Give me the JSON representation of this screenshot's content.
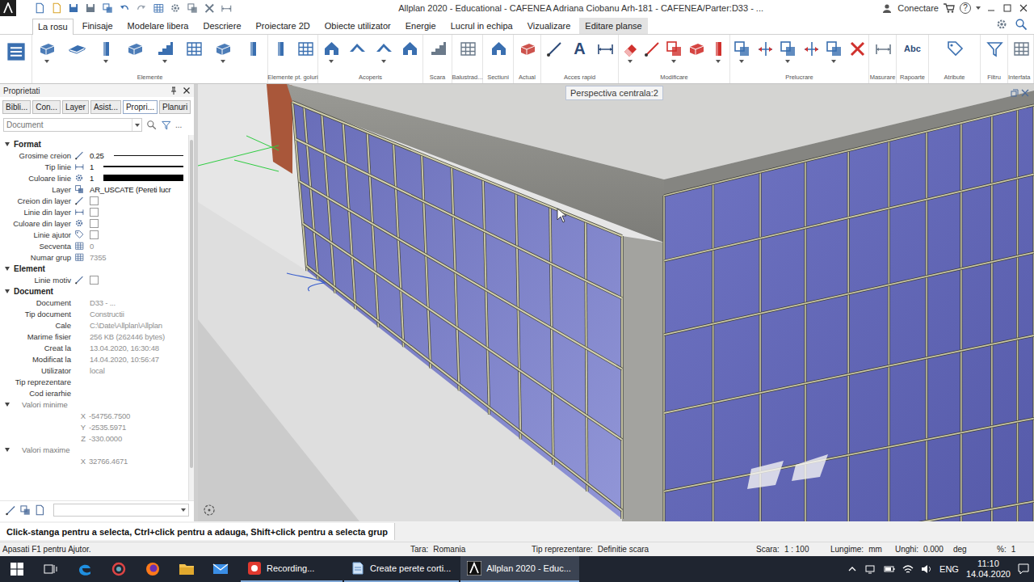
{
  "window": {
    "title": "Allplan 2020 - Educational - CAFENEA Adriana Ciobanu Arh-181 - CAFENEA/Parter:D33 - ...",
    "account": "Conectare",
    "help": "?"
  },
  "ribbon": {
    "tabs": [
      {
        "label": "La rosu",
        "selected": true,
        "highlighted": false
      },
      {
        "label": "Finisaje",
        "selected": false,
        "highlighted": false
      },
      {
        "label": "Modelare libera",
        "selected": false,
        "highlighted": false
      },
      {
        "label": "Descriere",
        "selected": false,
        "highlighted": false
      },
      {
        "label": "Proiectare 2D",
        "selected": false,
        "highlighted": false
      },
      {
        "label": "Obiecte utilizator",
        "selected": false,
        "highlighted": false
      },
      {
        "label": "Energie",
        "selected": false,
        "highlighted": false
      },
      {
        "label": "Lucrul in echipa",
        "selected": false,
        "highlighted": false
      },
      {
        "label": "Vizualizare",
        "selected": false,
        "highlighted": false
      },
      {
        "label": "Editare planse",
        "selected": false,
        "highlighted": true
      }
    ],
    "groups": [
      {
        "label": "Elemente"
      },
      {
        "label": "Elemente pt. goluri"
      },
      {
        "label": "Acoperis"
      },
      {
        "label": "Scara"
      },
      {
        "label": "Balustrad..."
      },
      {
        "label": "Sectiuni"
      },
      {
        "label": "Actual"
      },
      {
        "label": "Acces rapid",
        "glyph": "A"
      },
      {
        "label": "Modificare"
      },
      {
        "label": "Prelucrare"
      },
      {
        "label": "Masurare"
      },
      {
        "label": "Rapoarte",
        "glyph": "Abc"
      },
      {
        "label": "Atribute"
      },
      {
        "label": "Filtru"
      },
      {
        "label": "Interfata"
      }
    ]
  },
  "panel": {
    "title": "Proprietati",
    "tabs": [
      {
        "label": "Bibli...",
        "selected": false
      },
      {
        "label": "Con...",
        "selected": false
      },
      {
        "label": "Layer",
        "selected": false
      },
      {
        "label": "Asist...",
        "selected": false
      },
      {
        "label": "Propri...",
        "selected": true
      },
      {
        "label": "Planuri",
        "selected": false
      }
    ],
    "filter": {
      "placeholder": "Document",
      "more": "..."
    },
    "sections": [
      {
        "label": "Format",
        "expanded": true,
        "rows": [
          {
            "label": "Grosime creion",
            "kind": "pen",
            "value": "0.25",
            "greyed": false
          },
          {
            "label": "Tip linie",
            "kind": "pen",
            "value": "1",
            "greyed": false
          },
          {
            "label": "Culoare linie",
            "kind": "swatch",
            "value": "1",
            "greyed": false
          },
          {
            "label": "Layer",
            "kind": "text",
            "value": "AR_USCATE (Pereti lucr",
            "greyed": false
          },
          {
            "label": "Creion din layer",
            "kind": "checkbox",
            "checked": false,
            "greyed": false
          },
          {
            "label": "Linie din layer",
            "kind": "checkbox",
            "checked": false,
            "greyed": false
          },
          {
            "label": "Culoare din layer",
            "kind": "checkbox",
            "checked": false,
            "greyed": false
          },
          {
            "label": "Linie ajutor",
            "kind": "checkbox",
            "checked": false,
            "greyed": false
          },
          {
            "label": "Secventa",
            "kind": "text",
            "value": "0",
            "greyed": true
          },
          {
            "label": "Numar grup",
            "kind": "text",
            "value": "7355",
            "greyed": true
          }
        ]
      },
      {
        "label": "Element",
        "expanded": true,
        "rows": [
          {
            "label": "Linie motiv",
            "kind": "checkbox",
            "checked": false,
            "greyed": false
          }
        ]
      },
      {
        "label": "Document",
        "expanded": true,
        "rows": [
          {
            "label": "Document",
            "kind": "text",
            "value": "D33 - ...",
            "greyed": true
          },
          {
            "label": "Tip document",
            "kind": "text",
            "value": "Constructii",
            "greyed": true
          },
          {
            "label": "Cale",
            "kind": "text",
            "value": "C:\\Date\\Allplan\\Allplan",
            "greyed": true
          },
          {
            "label": "Marime fisier",
            "kind": "text",
            "value": "256 KB (262446 bytes)",
            "greyed": true
          },
          {
            "label": "Creat la",
            "kind": "text",
            "value": "13.04.2020, 16:30:48",
            "greyed": true
          },
          {
            "label": "Modificat la",
            "kind": "text",
            "value": "14.04.2020, 10:56:47",
            "greyed": true
          },
          {
            "label": "Utilizator",
            "kind": "text",
            "value": "local",
            "greyed": true
          },
          {
            "label": "Tip reprezentare",
            "kind": "text",
            "value": "",
            "greyed": true
          },
          {
            "label": "Cod ierarhie",
            "kind": "text",
            "value": "",
            "greyed": true
          },
          {
            "label": "Valori minime",
            "kind": "group",
            "expanded": true,
            "greyed": true
          },
          {
            "label": "X",
            "kind": "coord",
            "value": "-54756.7500",
            "greyed": true
          },
          {
            "label": "Y",
            "kind": "coord",
            "value": "-2535.5971",
            "greyed": true
          },
          {
            "label": "Z",
            "kind": "coord",
            "value": "-330.0000",
            "greyed": true
          },
          {
            "label": "Valori maxime",
            "kind": "group",
            "expanded": true,
            "greyed": true
          },
          {
            "label": "X",
            "kind": "coord",
            "value": "32766.4671",
            "greyed": true
          }
        ]
      }
    ]
  },
  "viewport": {
    "view_label": "Perspectiva centrala:2"
  },
  "hint": "Click-stanga pentru a selecta, Ctrl+click pentru a adauga, Shift+click pentru a selecta grup",
  "status_bar": {
    "help": "Apasati F1 pentru Ajutor.",
    "fields": [
      {
        "label": "Tara:",
        "value": "Romania"
      },
      {
        "label": "Tip reprezentare:",
        "value": "Definitie scara"
      },
      {
        "label": "Scara:",
        "value": "1 : 100"
      },
      {
        "label": "Lungime:",
        "value": "mm"
      },
      {
        "label": "Unghi:",
        "value": "0.000",
        "unit": "deg"
      },
      {
        "label": "%:",
        "value": "1"
      }
    ]
  },
  "taskbar": {
    "apps": [
      {
        "label": "Recording...",
        "selected": false
      },
      {
        "label": "Create perete corti...",
        "selected": false
      },
      {
        "label": "Allplan 2020 - Educ...",
        "selected": true
      }
    ],
    "language": "ENG",
    "time": "11:10",
    "date": "14.04.2020"
  }
}
